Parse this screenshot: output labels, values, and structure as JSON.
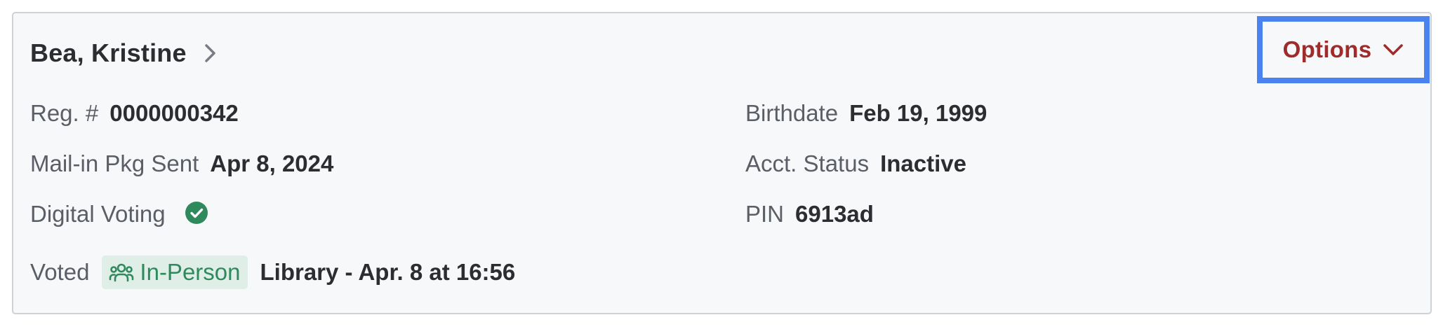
{
  "voter": {
    "name": "Bea, Kristine"
  },
  "options": {
    "label": "Options"
  },
  "fields": {
    "reg_label": "Reg. #",
    "reg_value": "0000000342",
    "birthdate_label": "Birthdate",
    "birthdate_value": "Feb 19, 1999",
    "mail_label": "Mail-in Pkg Sent",
    "mail_value": "Apr 8, 2024",
    "acct_label": "Acct. Status",
    "acct_value": "Inactive",
    "digital_label": "Digital Voting",
    "digital_status": "check-circle-icon",
    "pin_label": "PIN",
    "pin_value": "6913ad",
    "voted_label": "Voted",
    "voted_method": "In-Person",
    "voted_method_icon": "people-group-icon",
    "voted_detail": "Library - Apr. 8 at 16:56"
  },
  "colors": {
    "accent_red": "#a02b2b",
    "focus_blue": "#4a83f0",
    "success_green": "#2e8a5c",
    "badge_bg": "#dfeee6"
  }
}
